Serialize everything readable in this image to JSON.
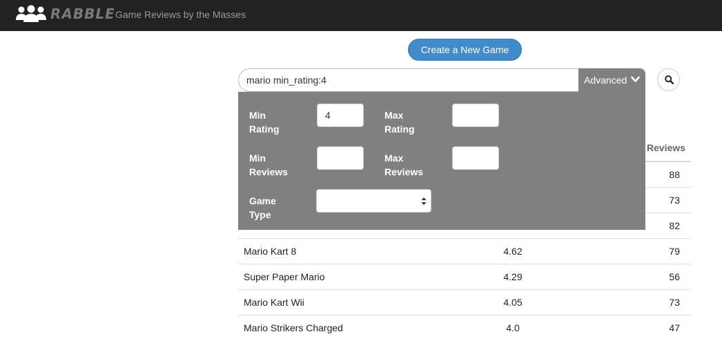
{
  "header": {
    "brand_name": "RABBLE",
    "tagline": "Game Reviews by the Masses"
  },
  "actions": {
    "create_label": "Create a New Game"
  },
  "search": {
    "query": "mario min_rating:4",
    "advanced_label": "Advanced"
  },
  "advanced_filters": {
    "min_rating_label": [
      "Min",
      "Rating"
    ],
    "min_rating_value": "4",
    "max_rating_label": [
      "Max",
      "Rating"
    ],
    "max_rating_value": "",
    "min_reviews_label": [
      "Min",
      "Reviews"
    ],
    "min_reviews_value": "",
    "max_reviews_label": [
      "Max",
      "Reviews"
    ],
    "max_reviews_value": "",
    "game_type_label": [
      "Game",
      "Type"
    ],
    "game_type_value": ""
  },
  "results": {
    "reviews_header": "Reviews",
    "rows": [
      {
        "name": "",
        "rating": "",
        "reviews": "88"
      },
      {
        "name": "",
        "rating": "",
        "reviews": "73"
      },
      {
        "name": "",
        "rating": "",
        "reviews": "82"
      },
      {
        "name": "Mario Kart 8",
        "rating": "4.62",
        "reviews": "79"
      },
      {
        "name": "Super Paper Mario",
        "rating": "4.29",
        "reviews": "56"
      },
      {
        "name": "Mario Kart Wii",
        "rating": "4.05",
        "reviews": "73"
      },
      {
        "name": "Mario Strikers Charged",
        "rating": "4.0",
        "reviews": "47"
      }
    ]
  },
  "colors": {
    "navbar": "#222222",
    "primary_button": "#428bca",
    "panel": "#808080"
  }
}
